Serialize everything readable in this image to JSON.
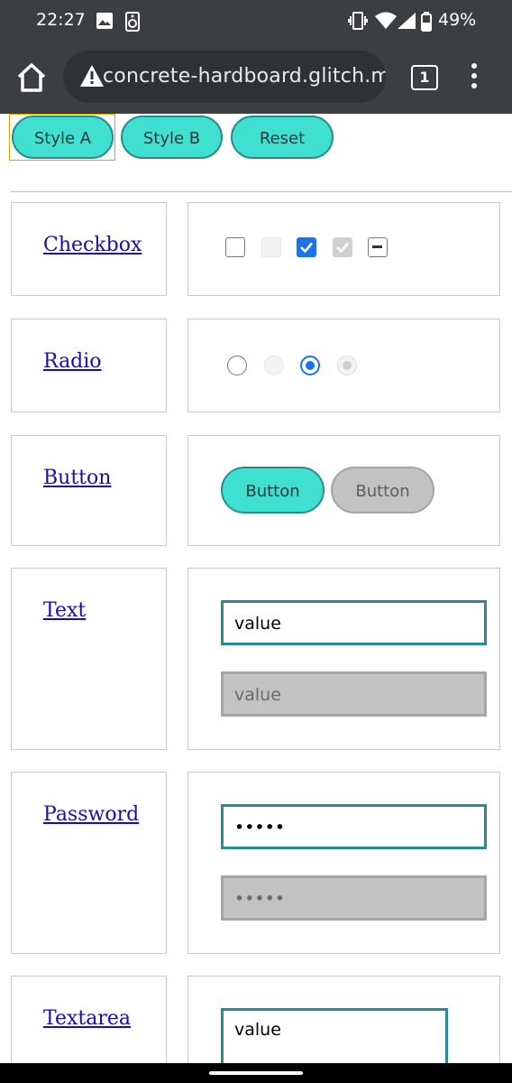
{
  "status_bar": {
    "time": "22:27",
    "battery": "49%",
    "icons": [
      "image-icon",
      "speaker-icon",
      "vibrate-icon",
      "wifi-icon",
      "signal-icon",
      "battery-icon"
    ]
  },
  "browser": {
    "url": "concrete-hardboard.glitch.me",
    "tab_count": "1",
    "security_icon": "warning-triangle-icon"
  },
  "style_buttons": {
    "style_a": "Style A",
    "style_b": "Style B",
    "reset": "Reset"
  },
  "rows": {
    "checkbox": {
      "label": "Checkbox"
    },
    "radio": {
      "label": "Radio"
    },
    "button": {
      "label": "Button",
      "enabled_label": "Button",
      "disabled_label": "Button"
    },
    "text": {
      "label": "Text",
      "value": "value",
      "disabled_value": "value"
    },
    "password": {
      "label": "Password",
      "value": "•••••",
      "disabled_value": "•••••"
    },
    "textarea": {
      "label": "Textarea",
      "value": "value"
    }
  },
  "colors": {
    "accent": "#40e0d0",
    "accent_border": "#2b8b95",
    "checked_blue": "#1a73e8",
    "browser_chrome": "#3c3f42"
  }
}
